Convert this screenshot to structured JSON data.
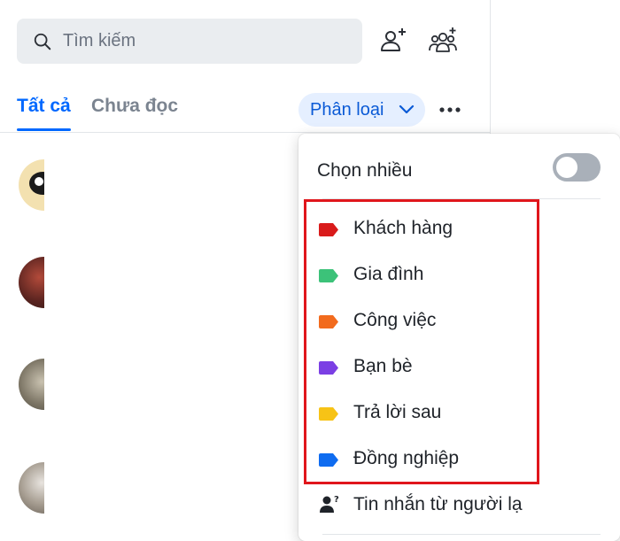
{
  "search": {
    "placeholder": "Tìm kiếm"
  },
  "tabs": [
    {
      "label": "Tất cả",
      "active": true
    },
    {
      "label": "Chưa đọc",
      "active": false
    }
  ],
  "filter": {
    "label": "Phân loại"
  },
  "menu": {
    "multi_select": {
      "label": "Chọn nhiều",
      "enabled": false
    },
    "tags": [
      {
        "label": "Khách hàng",
        "color": "#d91b1b"
      },
      {
        "label": "Gia đình",
        "color": "#3cc279"
      },
      {
        "label": "Công việc",
        "color": "#f26b1d"
      },
      {
        "label": "Bạn bè",
        "color": "#7b3fe4"
      },
      {
        "label": "Trả lời sau",
        "color": "#f7c316"
      },
      {
        "label": "Đồng nghiệp",
        "color": "#0f6cf0"
      }
    ],
    "stranger": {
      "label": "Tin nhắn từ người lạ"
    }
  },
  "colors": {
    "accent": "#0068ff",
    "highlight_box": "#e0161c"
  },
  "icons": {
    "search": "search-icon",
    "add_friend": "add-friend-icon",
    "create_group": "create-group-icon",
    "chevron": "chevron-down-icon",
    "more": "more-horizontal-icon",
    "tag": "tag-icon",
    "stranger": "unknown-person-icon"
  }
}
